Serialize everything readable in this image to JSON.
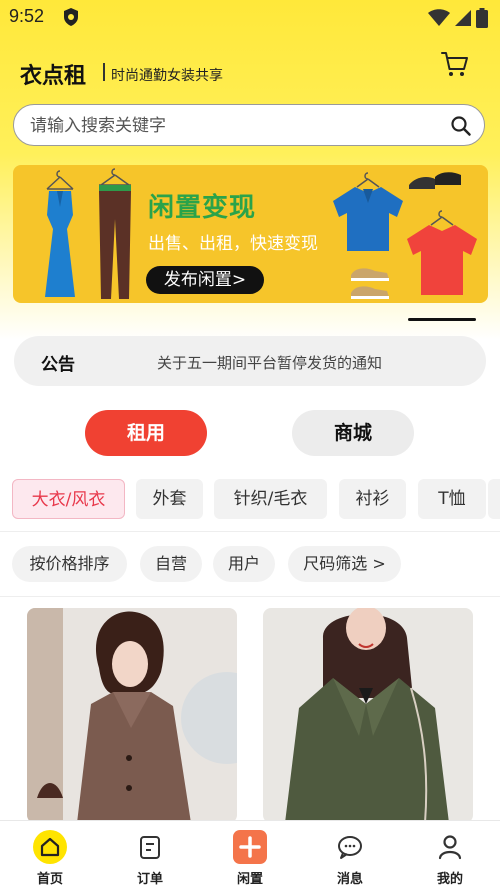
{
  "status_bar": {
    "time": "9:52"
  },
  "header": {
    "app_name": "衣点租",
    "tagline": "时尚通勤女装共享"
  },
  "search": {
    "placeholder": "请输入搜索关键字"
  },
  "banner": {
    "title": "闲置变现",
    "subtitle": "出售、出租，快速变现",
    "button_label": "发布闲置>"
  },
  "notice": {
    "label": "公告",
    "text": "关于五一期间平台暂停发货的通知"
  },
  "mode_toggle": {
    "options": [
      "租用",
      "商城"
    ],
    "selected": "租用"
  },
  "categories": {
    "items": [
      "大衣/风衣",
      "外套",
      "针织/毛衣",
      "衬衫",
      "T恤"
    ],
    "selected": "大衣/风衣"
  },
  "filters": [
    "按价格排序",
    "自营",
    "用户",
    "尺码筛选 >"
  ],
  "products": [
    {
      "image": "woman-brown-wool-coat"
    },
    {
      "image": "woman-olive-trench-coat"
    }
  ],
  "bottom_nav": [
    {
      "label": "首页",
      "icon": "home-icon",
      "active": true
    },
    {
      "label": "订单",
      "icon": "order-icon"
    },
    {
      "label": "闲置",
      "icon": "plus-icon"
    },
    {
      "label": "消息",
      "icon": "message-icon"
    },
    {
      "label": "我的",
      "icon": "user-icon"
    }
  ],
  "colors": {
    "brand_yellow": "#ffe83a",
    "accent_red": "#f04132",
    "category_active": "#e8384b",
    "banner_green": "#2aa34a",
    "nav_home_bg": "#ffe400",
    "nav_plus_bg": "#f4744a"
  }
}
